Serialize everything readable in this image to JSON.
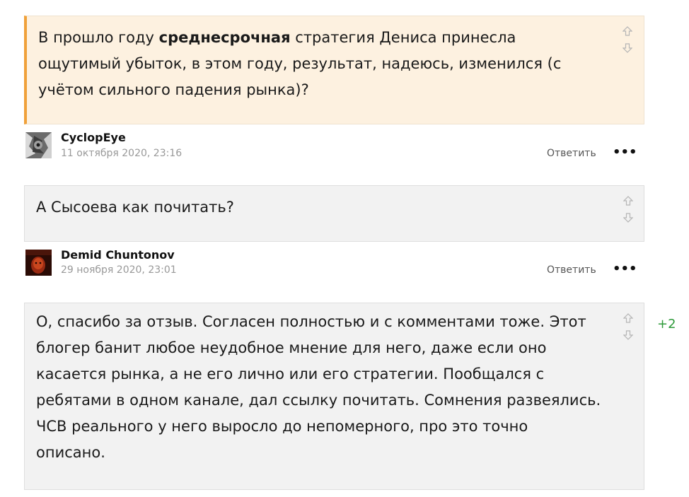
{
  "comments": [
    {
      "text_before": "В прошло году ",
      "text_bold": "среднесрочная",
      "text_after": " стратегия Дениса принесла ощутимый убыток, в этом году, результат, надеюсь, изменился (с учётом сильного падения рынка)?"
    },
    {
      "author": "CyclopEye",
      "date": "11 октября 2020, 23:16",
      "reply_label": "Ответить",
      "more_label": "•••",
      "text": "А Сысоева как почитать?"
    },
    {
      "author": "Demid Chuntonov",
      "date": "29 ноября 2020, 23:01",
      "reply_label": "Ответить",
      "more_label": "•••",
      "text": "О, спасибо за отзыв. Согласен полностью и с комментами тоже. Этот блогер банит любое неудобное мнение для него, даже если оно касается рынка, а не его лично или его стратегии. Пообщался с ребятами в одном канале, дал ссылку почитать. Сомнения развеялись. ЧСВ реального у него выросло до непомерного, про это точно описано.",
      "score": "+2"
    }
  ],
  "colors": {
    "accent": "#f0a13a",
    "highlight_bg": "#fdf1e0",
    "box_bg": "#f2f2f2",
    "score": "#2e9a3a"
  },
  "icons": [
    "upvote-icon",
    "downvote-icon"
  ]
}
